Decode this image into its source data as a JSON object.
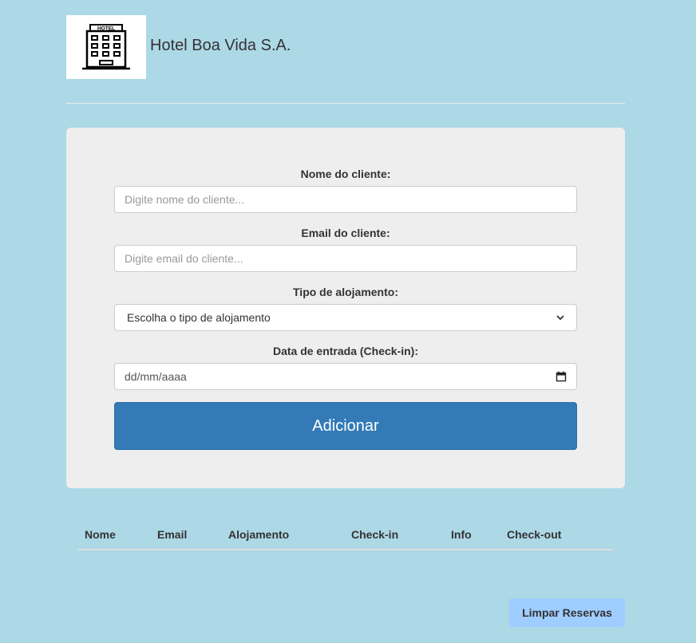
{
  "header": {
    "logo_sign": "HOTEL",
    "title": "Hotel Boa Vida S.A."
  },
  "form": {
    "name_label": "Nome do cliente:",
    "name_placeholder": "Digite nome do cliente...",
    "email_label": "Email do cliente:",
    "email_placeholder": "Digite email do cliente...",
    "type_label": "Tipo de alojamento:",
    "type_selected": "Escolha o tipo de alojamento",
    "date_label": "Data de entrada (Check-in):",
    "date_placeholder": "dd/mm/aaaa",
    "submit_label": "Adicionar"
  },
  "table": {
    "columns": [
      "Nome",
      "Email",
      "Alojamento",
      "Check-in",
      "Info",
      "Check-out"
    ],
    "rows": []
  },
  "clear_button_label": "Limpar Reservas",
  "colors": {
    "page_background": "#add8e6",
    "card_background": "#eeeeee",
    "primary_button": "#337ab7",
    "clear_button": "#9fcdff"
  },
  "icons": {
    "logo": "hotel-building-icon",
    "select_arrow": "chevron-down-icon",
    "date_picker": "calendar-icon"
  }
}
